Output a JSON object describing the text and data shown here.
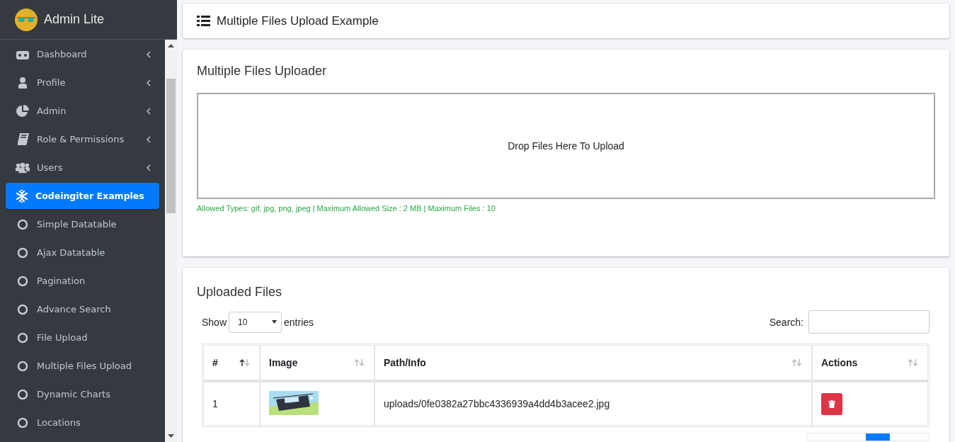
{
  "brand": {
    "title": "Admin Lite"
  },
  "sidebar": {
    "items": [
      {
        "label": "Dashboard",
        "expanded": false,
        "selected": false
      },
      {
        "label": "Profile",
        "expanded": false,
        "selected": false
      },
      {
        "label": "Admin",
        "expanded": false,
        "selected": false
      },
      {
        "label": "Role & Permissions",
        "expanded": false,
        "selected": false
      },
      {
        "label": "Users",
        "expanded": false,
        "selected": false
      },
      {
        "label": "Codeingiter Examples",
        "expanded": true,
        "selected": true,
        "children": [
          {
            "label": "Simple Datatable",
            "selected": false
          },
          {
            "label": "Ajax Datatable",
            "selected": false
          },
          {
            "label": "Pagination",
            "selected": false
          },
          {
            "label": "Advance Search",
            "selected": false
          },
          {
            "label": "File Upload",
            "selected": false
          },
          {
            "label": "Multiple Files Upload",
            "selected": false
          },
          {
            "label": "Dynamic Charts",
            "selected": false
          },
          {
            "label": "Locations",
            "selected": false
          }
        ]
      }
    ]
  },
  "page_title": "Multiple Files Upload Example",
  "uploader": {
    "title": "Multiple Files Uploader",
    "dropzone": "Drop Files Here To Upload",
    "hint": "Allowed Types: gif, jpg, png, jpeg | Maximum Allowed Size : 2 MB | Maximum Files : 10"
  },
  "uploaded": {
    "title": "Uploaded Files",
    "show_label": "Show",
    "page_size": "10",
    "entries_label": "entries",
    "search_label": "Search:",
    "table": {
      "columns": [
        {
          "label": "#",
          "sorted": true
        },
        {
          "label": "Image",
          "sorted": false
        },
        {
          "label": "Path/Info",
          "sorted": false
        },
        {
          "label": "Actions",
          "sorted": false
        }
      ],
      "rows": [
        {
          "number": "1",
          "path": "uploads/0fe0382a27bbc4336939a4dd4b3acee2.jpg"
        }
      ]
    }
  }
}
